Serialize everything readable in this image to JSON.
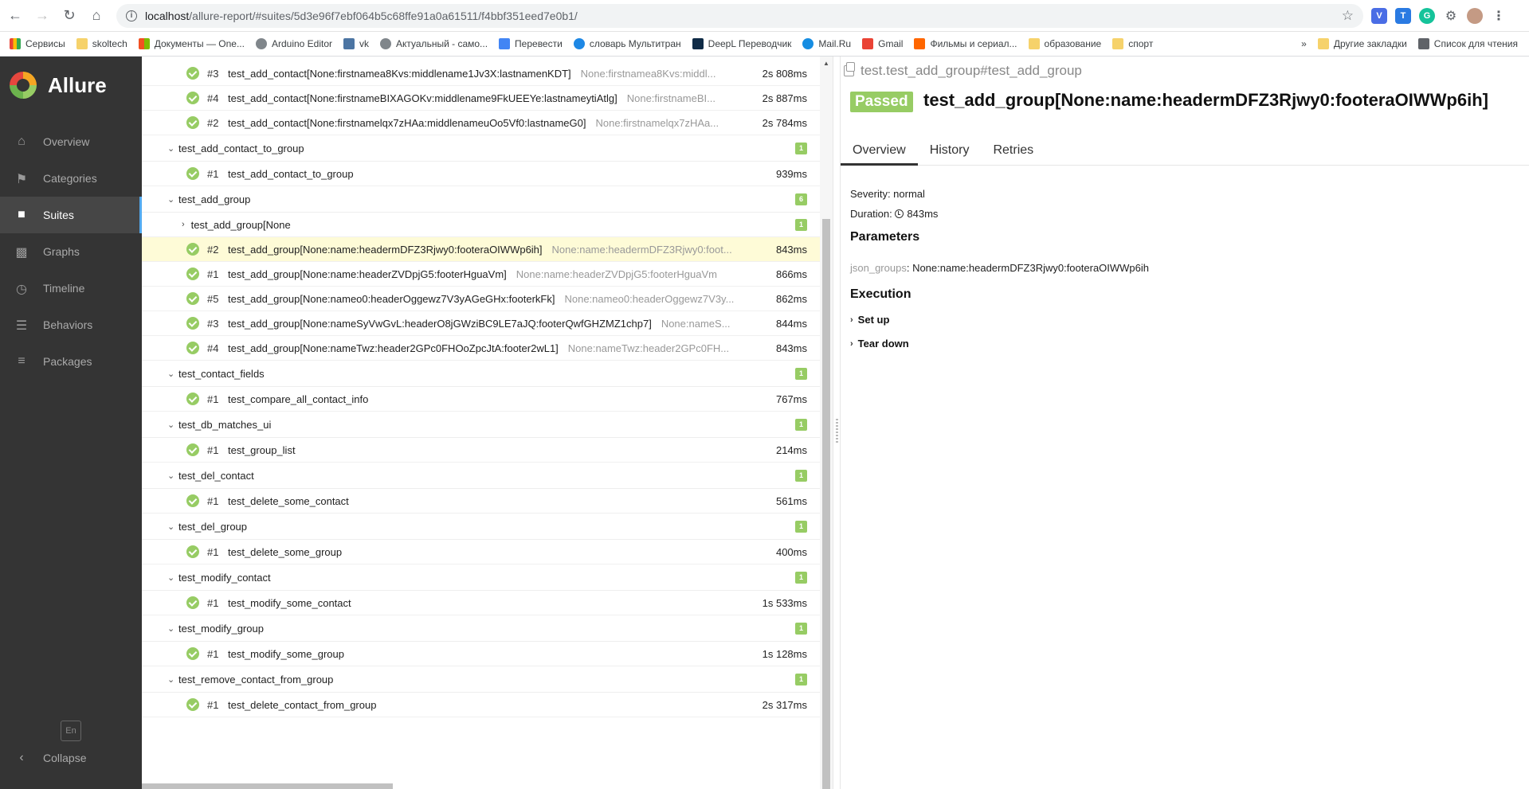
{
  "browser": {
    "url_host": "localhost",
    "url_rest": "/allure-report/#suites/5d3e96f7ebf064b5c68ffe91a0a61511/f4bbf351eed7e0b1/",
    "bookmarks": [
      "Сервисы",
      "skoltech",
      "Документы — One...",
      "Arduino Editor",
      "vk",
      "Актуальный - само...",
      "Перевести",
      "словарь Мультитран",
      "DeepL Переводчик",
      "Mail.Ru",
      "Gmail",
      "Фильмы и сериал...",
      "образование",
      "спорт"
    ],
    "bookmarks_more": "»",
    "other_bookmarks": "Другие закладки",
    "reading_list": "Список для чтения",
    "ext_v": "V",
    "ext_t": "T",
    "ext_g": "G"
  },
  "sidebar": {
    "brand": "Allure",
    "items": [
      {
        "label": "Overview",
        "icon": "home-icon"
      },
      {
        "label": "Categories",
        "icon": "flag-icon"
      },
      {
        "label": "Suites",
        "icon": "briefcase-icon"
      },
      {
        "label": "Graphs",
        "icon": "bar-chart-icon"
      },
      {
        "label": "Timeline",
        "icon": "clock-icon"
      },
      {
        "label": "Behaviors",
        "icon": "list-icon"
      },
      {
        "label": "Packages",
        "icon": "align-left-icon"
      }
    ],
    "active": "Suites",
    "lang": "En",
    "collapse": "Collapse"
  },
  "tree": {
    "top_rows": [
      {
        "num": "#3",
        "name": "test_add_contact[None:firstnamea8Kvs:middlename1Jv3X:lastnamenKDT]",
        "params": "None:firstnamea8Kvs:middl...",
        "dur": "2s 808ms"
      },
      {
        "num": "#4",
        "name": "test_add_contact[None:firstnameBIXAGOKv:middlename9FkUEEYe:lastnameytiAtlg]",
        "params": "None:firstnameBI...",
        "dur": "2s 887ms"
      },
      {
        "num": "#2",
        "name": "test_add_contact[None:firstnamelqx7zHAa:middlenameuOo5Vf0:lastnameG0]",
        "params": "None:firstnamelqx7zHAa...",
        "dur": "2s 784ms"
      }
    ],
    "groups": [
      {
        "name": "test_add_contact_to_group",
        "count": "1",
        "rows": [
          {
            "num": "#1",
            "name": "test_add_contact_to_group",
            "params": "",
            "dur": "939ms"
          }
        ]
      },
      {
        "name": "test_add_group",
        "count": "6",
        "subgroup": "test_add_group[None",
        "subgroup_count": "1",
        "rows": [
          {
            "num": "#2",
            "name": "test_add_group[None:name:headermDFZ3Rjwy0:footeraOIWWp6ih]",
            "params": "None:name:headermDFZ3Rjwy0:foot...",
            "dur": "843ms"
          },
          {
            "num": "#1",
            "name": "test_add_group[None:name:headerZVDpjG5:footerHguaVm]",
            "params": "None:name:headerZVDpjG5:footerHguaVm",
            "dur": "866ms"
          },
          {
            "num": "#5",
            "name": "test_add_group[None:nameo0:headerOggewz7V3yAGeGHx:footerkFk]",
            "params": "None:nameo0:headerOggewz7V3y...",
            "dur": "862ms"
          },
          {
            "num": "#3",
            "name": "test_add_group[None:nameSyVwGvL:headerO8jGWziBC9LE7aJQ:footerQwfGHZMZ1chp7]",
            "params": "None:nameS...",
            "dur": "844ms"
          },
          {
            "num": "#4",
            "name": "test_add_group[None:nameTwz:header2GPc0FHOoZpcJtA:footer2wL1]",
            "params": "None:nameTwz:header2GPc0FH...",
            "dur": "843ms"
          }
        ]
      },
      {
        "name": "test_contact_fields",
        "count": "1",
        "rows": [
          {
            "num": "#1",
            "name": "test_compare_all_contact_info",
            "params": "",
            "dur": "767ms"
          }
        ]
      },
      {
        "name": "test_db_matches_ui",
        "count": "1",
        "rows": [
          {
            "num": "#1",
            "name": "test_group_list",
            "params": "",
            "dur": "214ms"
          }
        ]
      },
      {
        "name": "test_del_contact",
        "count": "1",
        "rows": [
          {
            "num": "#1",
            "name": "test_delete_some_contact",
            "params": "",
            "dur": "561ms"
          }
        ]
      },
      {
        "name": "test_del_group",
        "count": "1",
        "rows": [
          {
            "num": "#1",
            "name": "test_delete_some_group",
            "params": "",
            "dur": "400ms"
          }
        ]
      },
      {
        "name": "test_modify_contact",
        "count": "1",
        "rows": [
          {
            "num": "#1",
            "name": "test_modify_some_contact",
            "params": "",
            "dur": "1s 533ms"
          }
        ]
      },
      {
        "name": "test_modify_group",
        "count": "1",
        "rows": [
          {
            "num": "#1",
            "name": "test_modify_some_group",
            "params": "",
            "dur": "1s 128ms"
          }
        ]
      },
      {
        "name": "test_remove_contact_from_group",
        "count": "1",
        "rows": [
          {
            "num": "#1",
            "name": "test_delete_contact_from_group",
            "params": "",
            "dur": "2s 317ms"
          }
        ]
      }
    ]
  },
  "detail": {
    "path": "test.test_add_group#test_add_group",
    "status": "Passed",
    "title": "test_add_group[None:name:headermDFZ3Rjwy0:footeraOIWWp6ih]",
    "tabs": [
      "Overview",
      "History",
      "Retries"
    ],
    "severity": "Severity: normal",
    "duration_label": "Duration:",
    "duration": "843ms",
    "parameters_title": "Parameters",
    "param_key": "json_groups",
    "param_value": "None:name:headermDFZ3Rjwy0:footeraOIWWp6ih",
    "execution_title": "Execution",
    "setup": "Set up",
    "teardown": "Tear down"
  },
  "colors": {
    "passed": "#97cc64",
    "sidebar": "#343434",
    "highlight": "#fefbd7",
    "accent": "#52aaf0"
  }
}
